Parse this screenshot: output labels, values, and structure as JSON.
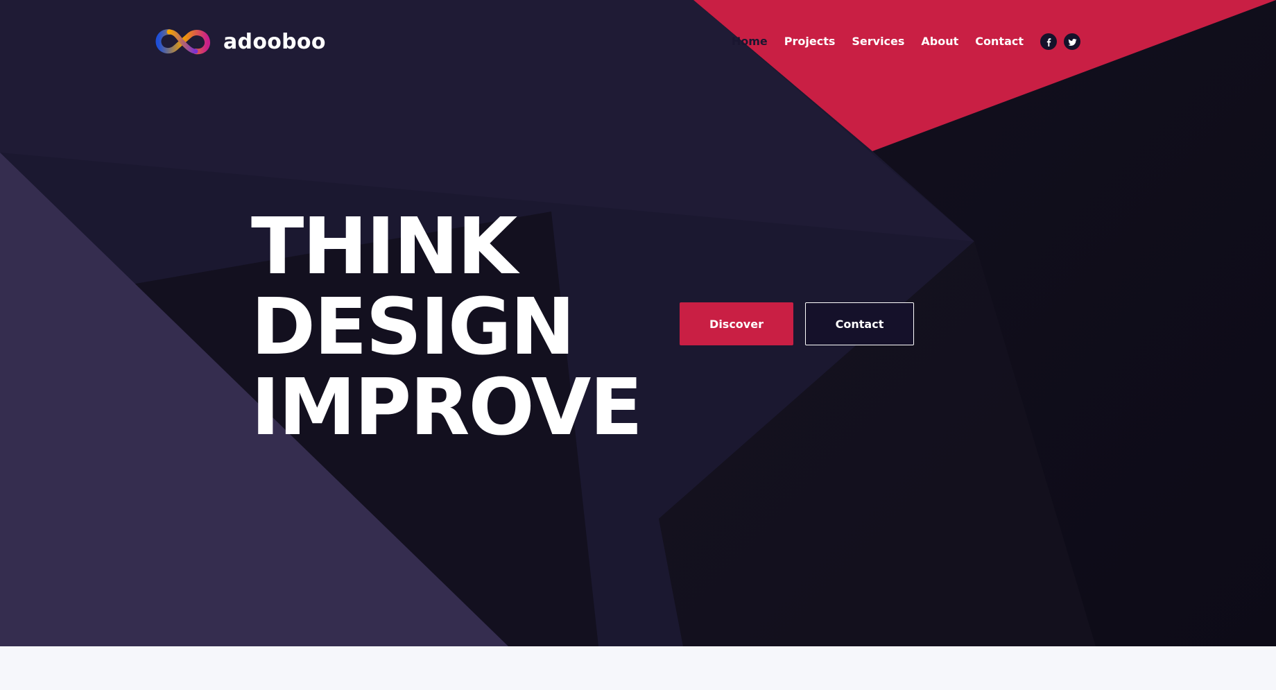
{
  "brand": {
    "name": "adooboo",
    "logo_icon": "infinity-logo-icon"
  },
  "nav": {
    "items": [
      {
        "label": "Home",
        "active": true
      },
      {
        "label": "Projects",
        "active": false
      },
      {
        "label": "Services",
        "active": false
      },
      {
        "label": "About",
        "active": false
      },
      {
        "label": "Contact",
        "active": false
      }
    ],
    "social": [
      {
        "icon": "facebook-icon"
      },
      {
        "icon": "twitter-icon"
      }
    ]
  },
  "hero": {
    "lines": [
      "THINK",
      "DESIGN",
      "IMPROVE"
    ],
    "primary_button": "Discover",
    "secondary_button": "Contact"
  },
  "colors": {
    "background": "#1b1830",
    "accent": "#c91f44",
    "light_band": "#f6f7fb",
    "text": "#ffffff",
    "active_nav": "#1a1630"
  }
}
